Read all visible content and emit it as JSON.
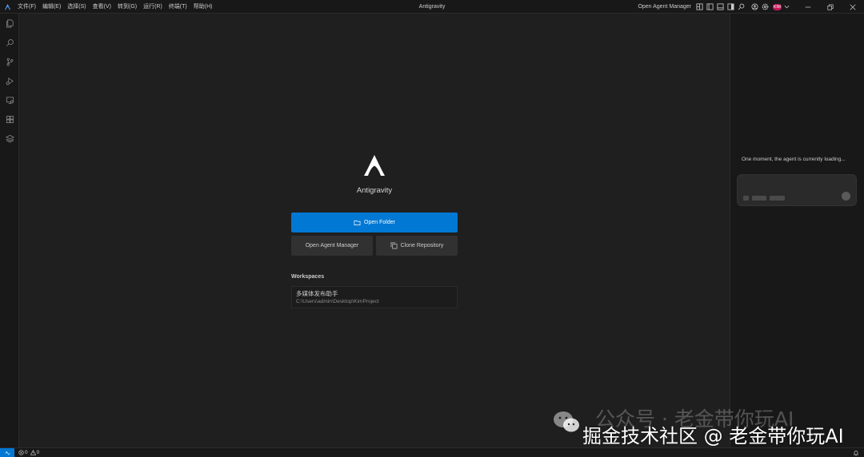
{
  "app": {
    "window_title": "Antigravity",
    "name": "Antigravity"
  },
  "menu": {
    "items": [
      "文件(F)",
      "编辑(E)",
      "选择(S)",
      "查看(V)",
      "转到(G)",
      "运行(R)",
      "终端(T)",
      "帮助(H)"
    ]
  },
  "titlebar": {
    "agent_manager_label": "Open Agent Manager",
    "avatar_initials": "KIM"
  },
  "welcome": {
    "open_folder_label": "Open Folder",
    "open_agent_manager_label": "Open Agent Manager",
    "clone_repository_label": "Clone Repository",
    "workspaces_heading": "Workspaces",
    "workspaces": [
      {
        "name": "多媒体发布助手",
        "path": "C:\\Users\\admin\\Desktop\\KimProject"
      }
    ]
  },
  "agent_panel": {
    "loading_text": "One moment, the agent is currently loading..."
  },
  "statusbar": {
    "errors": "0",
    "warnings": "0"
  },
  "watermark": {
    "back_text": "公众号 · 老金带你玩AI",
    "front_text": "掘金技术社区 @ 老金带你玩AI"
  },
  "colors": {
    "accent": "#0078d4",
    "background": "#1f1f1f",
    "sidebar": "#181818"
  }
}
